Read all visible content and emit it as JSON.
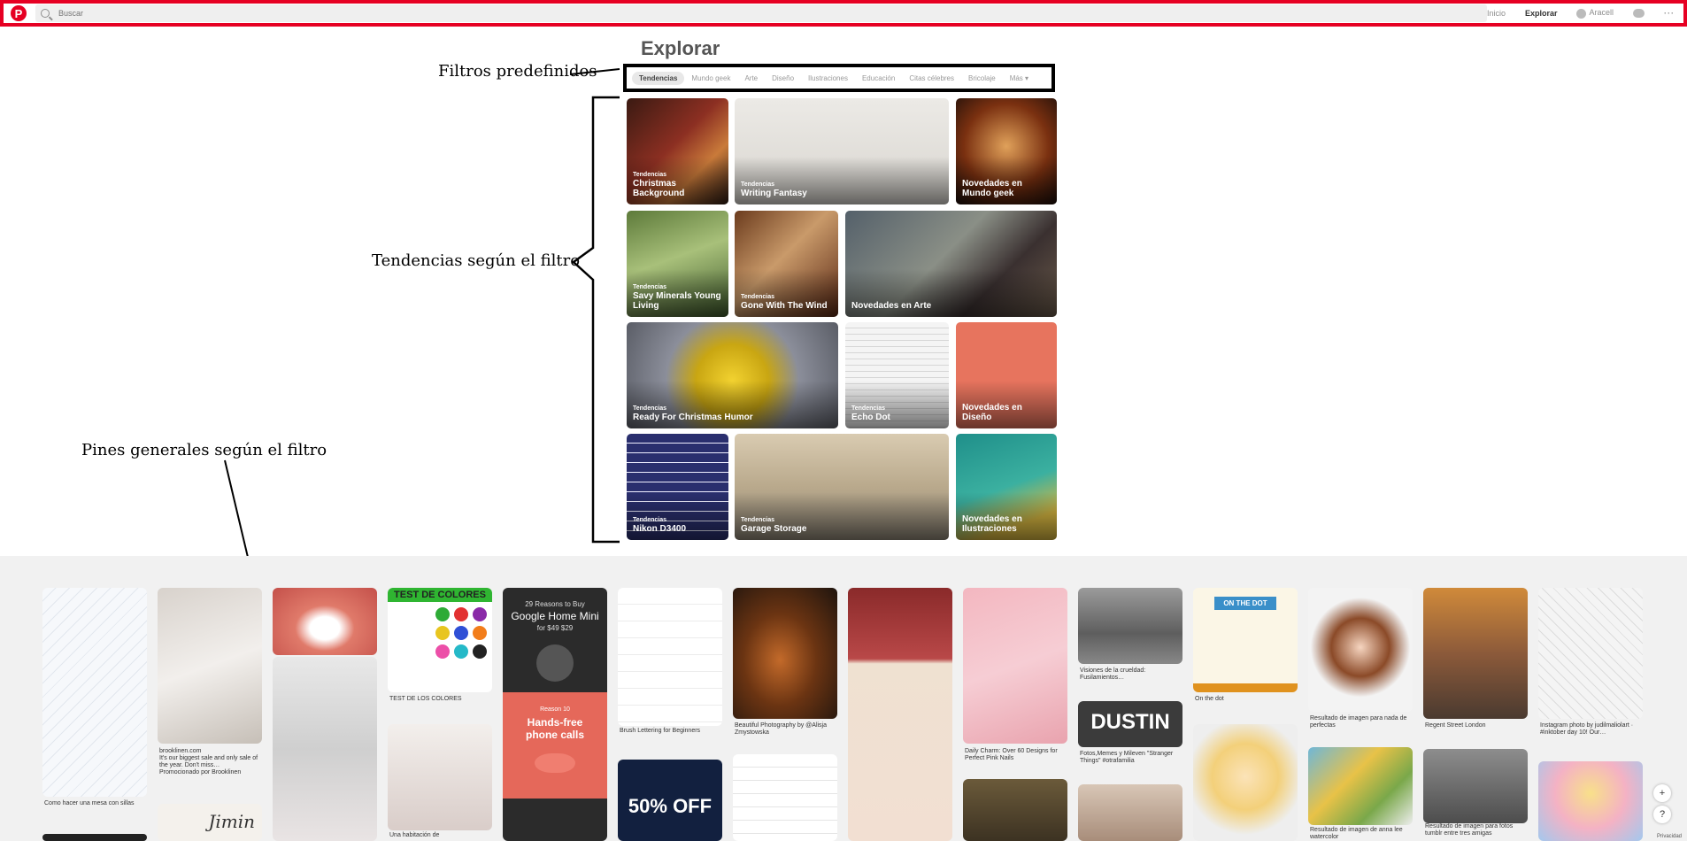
{
  "topbar": {
    "logo": "P",
    "search_placeholder": "Buscar",
    "nav": {
      "home": "Inicio",
      "explore": "Explorar",
      "user": "Aracell"
    },
    "icons": [
      "search-icon",
      "avatar-icon",
      "chat-icon",
      "more-icon"
    ]
  },
  "page_title": "Explorar",
  "filters": [
    "Tendencias",
    "Mundo geek",
    "Arte",
    "Diseño",
    "Ilustraciones",
    "Educación",
    "Citas célebres",
    "Bricolaje",
    "Más"
  ],
  "annotations": {
    "filters": "Filtros predefinidos",
    "trends": "Tendencias según el filtro",
    "pins": "Pines generales según el filtro"
  },
  "trends": [
    {
      "tag": "Tendencias",
      "name": "Christmas Background"
    },
    {
      "tag": "Tendencias",
      "name": "Writing Fantasy"
    },
    {
      "tag": "",
      "name": "Novedades en Mundo geek"
    },
    {
      "tag": "Tendencias",
      "name": "Savy Minerals Young Living"
    },
    {
      "tag": "Tendencias",
      "name": "Gone With The Wind"
    },
    {
      "tag": "",
      "name": "Novedades en Arte"
    },
    {
      "tag": "Tendencias",
      "name": "Ready For Christmas Humor"
    },
    {
      "tag": "Tendencias",
      "name": "Echo Dot"
    },
    {
      "tag": "",
      "name": "Novedades en Diseño"
    },
    {
      "tag": "Tendencias",
      "name": "Nikon D3400"
    },
    {
      "tag": "Tendencias",
      "name": "Garage Storage"
    },
    {
      "tag": "",
      "name": "Novedades en Ilustraciones"
    }
  ],
  "pins": [
    {
      "caption": "Como hacer una mesa con sillas"
    },
    {
      "caption": "brooklinen.com\nIt's our biggest sale and only sale of the year. Don't miss…\nPromocionado por Brooklinen"
    },
    {
      "caption": ""
    },
    {
      "caption": "TEST DE LOS COLORES"
    },
    {
      "caption": ""
    },
    {
      "caption": "Brush Lettering for Beginners"
    },
    {
      "caption": "Beautiful Photography by @Alisja Zmystowska"
    },
    {
      "caption": ""
    },
    {
      "caption": "Daily Charm: Over 60 Designs for Perfect Pink Nails"
    },
    {
      "caption": "Visiones de la crueldad: Fusilamientos…"
    },
    {
      "caption": "On the dot"
    },
    {
      "caption": "Resultado de imagen para nada de perfectas"
    },
    {
      "caption": "Regent Street London"
    },
    {
      "caption": "Instagram photo by judilmaliolart · #inktober day 10! Our…"
    },
    {
      "caption": "Una habitación de"
    },
    {
      "caption": "Fotos,Memes y Mileven \"Stranger Things\" #otrafamilia"
    },
    {
      "caption": "Resultado de imagen de anna lee watercolor"
    },
    {
      "caption": "Resultado de imagen para fotos tumblr entre tres amigas"
    }
  ],
  "pin_texts": {
    "test_colores": "TEST DE COLORES",
    "google_a": "29 Reasons to Buy",
    "google_b": "Google Home Mini",
    "google_c": "for $49 $29",
    "google_d": "Reason 10",
    "google_e": "Hands-free phone calls",
    "discount": "50% OFF",
    "dustin": "DUSTIN",
    "jimin": "Jimin",
    "on_the_dot": "ON THE DOT"
  },
  "side_buttons": [
    "+",
    "?"
  ],
  "privacy": "Privacidad"
}
